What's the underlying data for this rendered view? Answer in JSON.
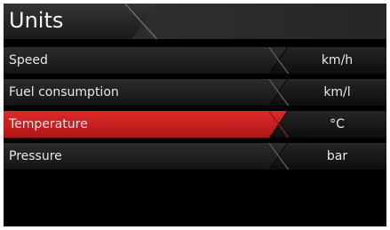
{
  "header": {
    "title": "Units"
  },
  "rows": [
    {
      "label": "Speed",
      "value": "km/h",
      "selected": false
    },
    {
      "label": "Fuel consumption",
      "value": "km/l",
      "selected": false
    },
    {
      "label": "Temperature",
      "value": "°C",
      "selected": true
    },
    {
      "label": "Pressure",
      "value": "bar",
      "selected": false
    }
  ],
  "colors": {
    "background": "#000000",
    "row": "#1f1f1f",
    "selected_row": "#d32020",
    "text": "#e8e8e8"
  }
}
